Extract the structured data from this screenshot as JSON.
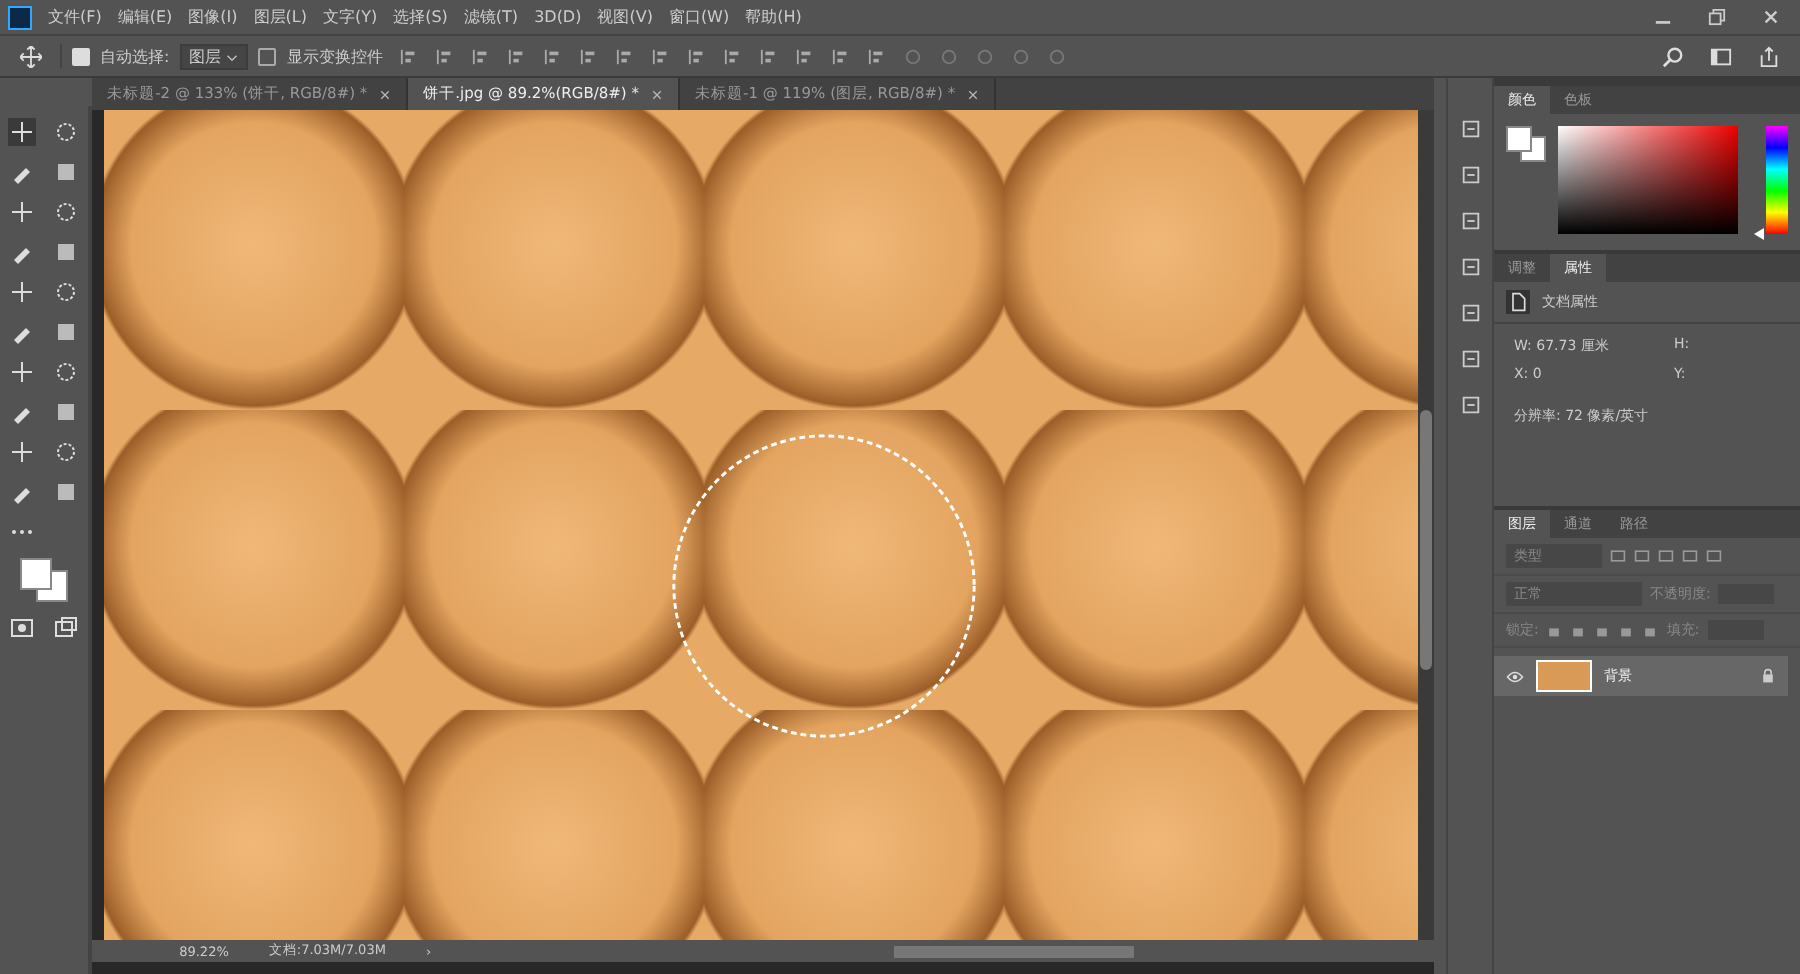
{
  "menu": [
    "文件(F)",
    "编辑(E)",
    "图像(I)",
    "图层(L)",
    "文字(Y)",
    "选择(S)",
    "滤镜(T)",
    "3D(D)",
    "视图(V)",
    "窗口(W)",
    "帮助(H)"
  ],
  "options_bar": {
    "auto_select": {
      "label": "自动选择:",
      "checked": true
    },
    "target": "图层",
    "show_transform": {
      "label": "显示变换控件",
      "checked": false
    }
  },
  "tabs": [
    {
      "label": "未标题-2 @ 133% (饼干, RGB/8#) *",
      "selected": false
    },
    {
      "label": "饼干.jpg @ 89.2%(RGB/8#) *",
      "selected": true
    },
    {
      "label": "未标题-1 @ 119% (图层, RGB/8#) *",
      "selected": false
    }
  ],
  "status_bar": {
    "zoom": "89.22%",
    "doc": "文档:7.03M/7.03M",
    "arrow": "›"
  },
  "color_panel": {
    "tabs": [
      {
        "label": "颜色",
        "selected": true
      },
      {
        "label": "色板",
        "selected": false
      }
    ],
    "hue": {
      "level": 0
    }
  },
  "properties_panel": {
    "tabs": [
      {
        "label": "调整",
        "selected": false
      },
      {
        "label": "属性",
        "selected": true
      }
    ],
    "title": "文档属性",
    "w_label": "W:",
    "w_value": "67.73 厘米",
    "h_label": "H:",
    "x_label": "X:",
    "x_value": "0",
    "y_label": "Y:",
    "resolution": "分辨率: 72 像素/英寸"
  },
  "layers_panel": {
    "tabs": [
      {
        "label": "图层",
        "selected": true
      },
      {
        "label": "通道",
        "selected": false
      },
      {
        "label": "路径",
        "selected": false
      }
    ],
    "filter_placeholder": "类型",
    "blend_mode": "正常",
    "opacity_label": "不透明度:",
    "lock_label": "锁定:",
    "fill_label": "填充:",
    "layers": [
      {
        "name": "背景",
        "visible": true,
        "selected": true,
        "locked": true
      }
    ]
  }
}
